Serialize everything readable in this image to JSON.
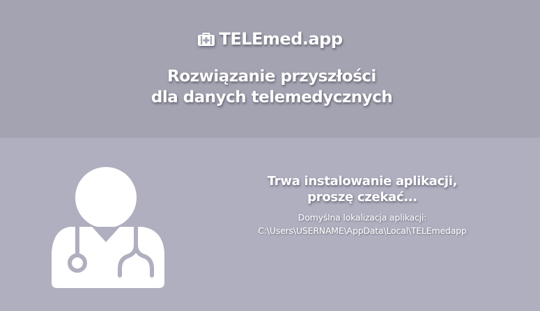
{
  "header": {
    "app_name": "TELEmed.app",
    "brand_icon": "medical-briefcase-icon",
    "tagline_line1": "Rozwiązanie przyszłości",
    "tagline_line2": "dla danych telemedycznych"
  },
  "installer": {
    "illustration_icon": "doctor-stethoscope-icon",
    "status_line1": "Trwa instalowanie aplikacji,",
    "status_line2": "proszę czekać...",
    "location_label": "Domyślna lokalizacja aplikacji:",
    "location_path": "C:\\Users\\USERNAME\\AppData\\Local\\TELEmedapp"
  },
  "colors": {
    "header_bg": "#a3a3b1",
    "body_bg": "#afafbf",
    "text": "#ffffff"
  }
}
